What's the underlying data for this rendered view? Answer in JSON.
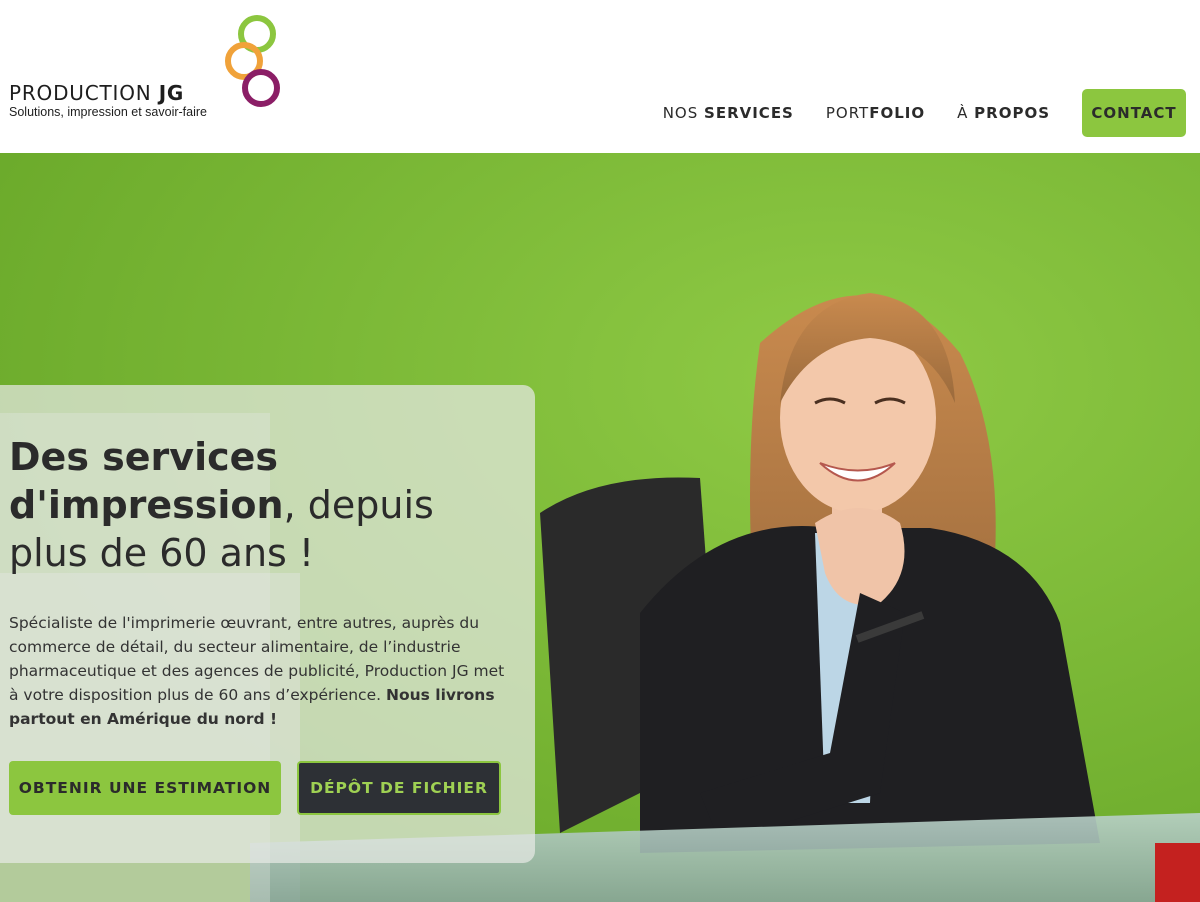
{
  "brand": {
    "title_regular": "PRODUCTION ",
    "title_bold": "JG",
    "tagline": "Solutions, impression et savoir-faire",
    "ring_colors": [
      "#8cc63f",
      "#f0a23a",
      "#8b1e66"
    ]
  },
  "nav": {
    "services_prefix": "NOS ",
    "services_bold": "SERVICES",
    "portfolio_prefix": "PORT",
    "portfolio_bold": "FOLIO",
    "about_prefix": "À ",
    "about_bold": "PROPOS",
    "contact": "CONTACT"
  },
  "hero": {
    "title_bold": "Des services d'impression",
    "title_rest": ", depuis plus de 60 ans !",
    "text": "Spécialiste de l'imprimerie œuvrant, entre autres, auprès du commerce de détail, du secteur alimentaire, de l’industrie pharmaceutique et des agences de publicité, Production JG met à votre disposition plus de 60 ans d’expérience. ",
    "text_bold": "Nous livrons partout en Amérique du nord !",
    "btn_estimate": "OBTENIR UNE ESTIMATION",
    "btn_upload": "DÉPÔT DE FICHIER"
  },
  "colors": {
    "accent_green": "#8cc63f",
    "dark_button": "#2d3035",
    "text_dark": "#2b2b2b"
  }
}
